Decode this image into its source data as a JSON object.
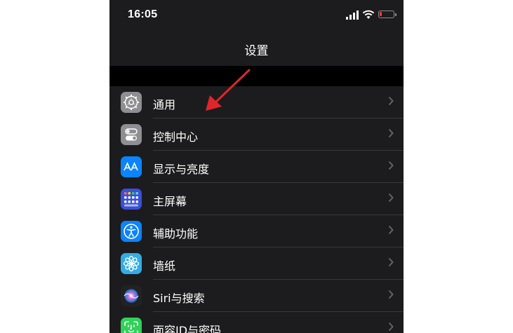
{
  "status_bar": {
    "time": "16:05"
  },
  "nav": {
    "title": "设置"
  },
  "settings_items": [
    {
      "label": "通用",
      "icon": "gear-icon",
      "color": "#8e8e93"
    },
    {
      "label": "控制中心",
      "icon": "toggles-icon",
      "color": "#8e8e93"
    },
    {
      "label": "显示与亮度",
      "icon": "text-size-icon",
      "color": "#0a84ff"
    },
    {
      "label": "主屏幕",
      "icon": "home-grid-icon",
      "color": "#3a50d9"
    },
    {
      "label": "辅助功能",
      "icon": "accessibility-icon",
      "color": "#0a84ff"
    },
    {
      "label": "墙纸",
      "icon": "flower-icon",
      "color": "#32ade6"
    },
    {
      "label": "Siri与搜索",
      "icon": "siri-icon",
      "color": "#222222"
    },
    {
      "label": "面容ID与密码",
      "icon": "face-id-icon",
      "color": "#30d158"
    }
  ],
  "colors": {
    "background": "#1c1c1e",
    "band": "#000000",
    "annotation_arrow": "#e0262b",
    "battery_low": "#ff3b30"
  },
  "annotation": {
    "type": "red-arrow",
    "points_to": "通用"
  }
}
